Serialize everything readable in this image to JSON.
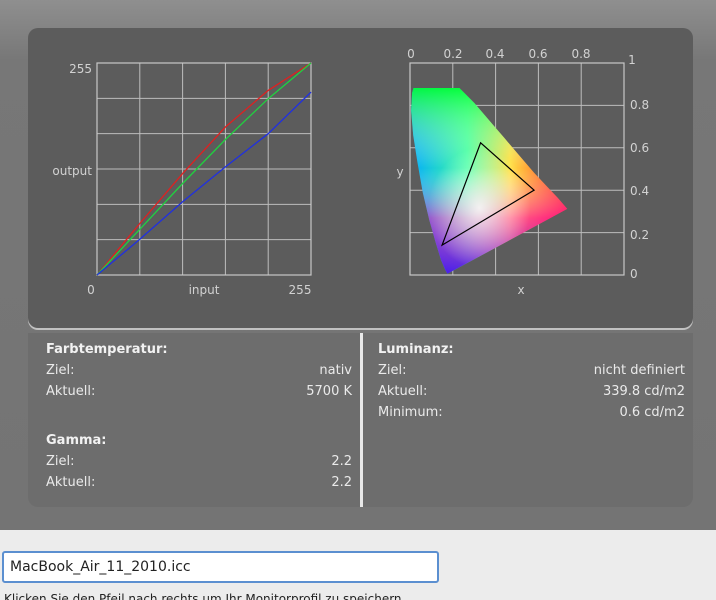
{
  "gamma_chart": {
    "y_max_label": "255",
    "y_label": "output",
    "x_min_label": "0",
    "x_label": "input",
    "x_max_label": "255"
  },
  "cie_chart": {
    "x_ticks": [
      "0",
      "0.2",
      "0.4",
      "0.6",
      "0.8",
      "1"
    ],
    "y_ticks": [
      "0.8",
      "0.6",
      "0.4",
      "0.2",
      "0"
    ],
    "x_label": "x",
    "y_label": "y"
  },
  "chart_data": [
    {
      "type": "line",
      "xlabel": "input",
      "ylabel": "output",
      "xlim": [
        0,
        255
      ],
      "ylim": [
        0,
        255
      ],
      "x": [
        0,
        51,
        102,
        153,
        204,
        255
      ],
      "series": [
        {
          "color": "#e02020",
          "values": [
            0,
            62,
            122,
            178,
            222,
            255
          ]
        },
        {
          "color": "#20d040",
          "values": [
            0,
            55,
            110,
            163,
            212,
            255
          ]
        },
        {
          "color": "#2030e0",
          "values": [
            0,
            43,
            88,
            130,
            170,
            220
          ]
        }
      ]
    },
    {
      "type": "scatter",
      "xlabel": "x",
      "ylabel": "y",
      "xlim": [
        0,
        1
      ],
      "ylim": [
        0,
        0.85
      ],
      "gamut_triangle": [
        [
          0.58,
          0.34
        ],
        [
          0.33,
          0.53
        ],
        [
          0.15,
          0.12
        ]
      ]
    }
  ],
  "color_temperature": {
    "title": "Farbtemperatur:",
    "target_label": "Ziel:",
    "target_value": "nativ",
    "current_label": "Aktuell:",
    "current_value": "5700 K"
  },
  "gamma": {
    "title": "Gamma:",
    "target_label": "Ziel:",
    "target_value": "2.2",
    "current_label": "Aktuell:",
    "current_value": "2.2"
  },
  "luminance": {
    "title": "Luminanz:",
    "target_label": "Ziel:",
    "target_value": "nicht definiert",
    "current_label": "Aktuell:",
    "current_value": "339.8 cd/m2",
    "minimum_label": "Minimum:",
    "minimum_value": "0.6 cd/m2"
  },
  "filename": {
    "value": "MacBook_Air_11_2010.icc"
  },
  "hint_text": "Klicken Sie den Pfeil nach rechts um Ihr Monitorprofil zu speichern."
}
